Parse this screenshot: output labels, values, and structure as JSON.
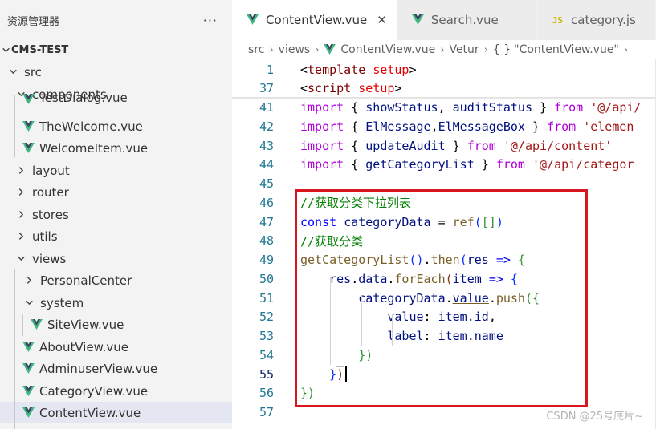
{
  "sidebar": {
    "title": "资源管理器",
    "more": "···",
    "project": "CMS-TEST",
    "items": [
      {
        "label": "src",
        "type": "folder",
        "open": true
      },
      {
        "label": "components",
        "type": "folder",
        "open": true
      },
      {
        "label": "TestDialog.vue",
        "type": "vue"
      },
      {
        "label": "TheWelcome.vue",
        "type": "vue"
      },
      {
        "label": "WelcomeItem.vue",
        "type": "vue"
      },
      {
        "label": "layout",
        "type": "folder",
        "open": false
      },
      {
        "label": "router",
        "type": "folder",
        "open": false
      },
      {
        "label": "stores",
        "type": "folder",
        "open": false
      },
      {
        "label": "utils",
        "type": "folder",
        "open": false
      },
      {
        "label": "views",
        "type": "folder",
        "open": true
      },
      {
        "label": "PersonalCenter",
        "type": "folder",
        "open": false
      },
      {
        "label": "system",
        "type": "folder",
        "open": true
      },
      {
        "label": "SiteView.vue",
        "type": "vue"
      },
      {
        "label": "AboutView.vue",
        "type": "vue"
      },
      {
        "label": "AdminuserView.vue",
        "type": "vue"
      },
      {
        "label": "CategoryView.vue",
        "type": "vue"
      },
      {
        "label": "ContentView.vue",
        "type": "vue",
        "selected": true
      }
    ]
  },
  "tabs": [
    {
      "label": "ContentView.vue",
      "icon": "vue-icon",
      "active": true,
      "close": "✕"
    },
    {
      "label": "Search.vue",
      "icon": "vue-icon",
      "active": false
    },
    {
      "label": "category.js",
      "icon": "js-icon",
      "badge": "JS",
      "active": false
    }
  ],
  "breadcrumb": {
    "parts": [
      "src",
      "views",
      "ContentView.vue",
      "Vetur",
      "\"ContentView.vue\""
    ],
    "curly": "{ }"
  },
  "code": {
    "line_numbers": [
      "1",
      "37",
      "41",
      "42",
      "43",
      "44",
      "45",
      "46",
      "47",
      "48",
      "49",
      "50",
      "51",
      "52",
      "53",
      "54",
      "55",
      "56",
      "57"
    ],
    "lines": [
      [
        [
          "t-pn",
          "<"
        ],
        [
          "t-tag",
          "template"
        ],
        [
          "t-pn",
          " "
        ],
        [
          "t-attr",
          "setup"
        ],
        [
          "t-pn",
          ">"
        ]
      ],
      [
        [
          "t-pn",
          "<"
        ],
        [
          "t-tag",
          "script"
        ],
        [
          "t-pn",
          " "
        ],
        [
          "t-attr",
          "setup"
        ],
        [
          "t-pn",
          ">"
        ]
      ],
      [
        [
          "t-kw2",
          "import"
        ],
        [
          "t-pn",
          " { "
        ],
        [
          "t-var",
          "showStatus"
        ],
        [
          "t-pn",
          ", "
        ],
        [
          "t-var",
          "auditStatus"
        ],
        [
          "t-pn",
          " } "
        ],
        [
          "t-kw2",
          "from"
        ],
        [
          "t-pn",
          " "
        ],
        [
          "t-str",
          "'@/api/"
        ]
      ],
      [
        [
          "t-kw2",
          "import"
        ],
        [
          "t-pn",
          " { "
        ],
        [
          "t-var",
          "ElMessage"
        ],
        [
          "t-pn",
          ","
        ],
        [
          "t-var",
          "ElMessageBox"
        ],
        [
          "t-pn",
          " } "
        ],
        [
          "t-kw2",
          "from"
        ],
        [
          "t-pn",
          " "
        ],
        [
          "t-str",
          "'elemen"
        ]
      ],
      [
        [
          "t-kw2",
          "import"
        ],
        [
          "t-pn",
          " { "
        ],
        [
          "t-var",
          "updateAudit"
        ],
        [
          "t-pn",
          " } "
        ],
        [
          "t-kw2",
          "from"
        ],
        [
          "t-pn",
          " "
        ],
        [
          "t-str",
          "'@/api/content'"
        ]
      ],
      [
        [
          "t-kw2",
          "import"
        ],
        [
          "t-pn",
          " { "
        ],
        [
          "t-var",
          "getCategoryList"
        ],
        [
          "t-pn",
          " } "
        ],
        [
          "t-kw2",
          "from"
        ],
        [
          "t-pn",
          " "
        ],
        [
          "t-str",
          "'@/api/categor"
        ]
      ],
      [],
      [
        [
          "t-cm",
          "//获取分类下拉列表"
        ]
      ],
      [
        [
          "t-kw",
          "const"
        ],
        [
          "t-pn",
          " "
        ],
        [
          "t-var",
          "categoryData"
        ],
        [
          "t-pn",
          " = "
        ],
        [
          "t-fn",
          "ref"
        ],
        [
          "t-br1",
          "("
        ],
        [
          "t-br2",
          "[]"
        ],
        [
          "t-br1",
          ")"
        ]
      ],
      [
        [
          "t-cm",
          "//获取分类"
        ]
      ],
      [
        [
          "t-fn",
          "getCategoryList"
        ],
        [
          "t-br1",
          "()"
        ],
        [
          "t-pn",
          "."
        ],
        [
          "t-fn",
          "then"
        ],
        [
          "t-br1",
          "("
        ],
        [
          "t-var",
          "res"
        ],
        [
          "t-pn",
          " "
        ],
        [
          "t-kw",
          "=>"
        ],
        [
          "t-pn",
          " "
        ],
        [
          "t-br2",
          "{"
        ]
      ],
      [
        [
          "t-pn",
          "    "
        ],
        [
          "t-var",
          "res"
        ],
        [
          "t-pn",
          "."
        ],
        [
          "t-var",
          "data"
        ],
        [
          "t-pn",
          "."
        ],
        [
          "t-fn",
          "forEach"
        ],
        [
          "t-br3",
          "("
        ],
        [
          "t-var",
          "item"
        ],
        [
          "t-pn",
          " "
        ],
        [
          "t-kw",
          "=>"
        ],
        [
          "t-pn",
          " "
        ],
        [
          "t-br1",
          "{"
        ]
      ],
      [
        [
          "t-pn",
          "        "
        ],
        [
          "t-var",
          "categoryData"
        ],
        [
          "t-pn",
          "."
        ],
        [
          "t-var ul",
          "value"
        ],
        [
          "t-pn",
          "."
        ],
        [
          "t-fn",
          "push"
        ],
        [
          "t-br2",
          "({"
        ]
      ],
      [
        [
          "t-pn",
          "            "
        ],
        [
          "t-var",
          "value"
        ],
        [
          "t-pn",
          ": "
        ],
        [
          "t-var",
          "item"
        ],
        [
          "t-pn",
          "."
        ],
        [
          "t-var",
          "id"
        ],
        [
          "t-pn",
          ","
        ]
      ],
      [
        [
          "t-pn",
          "            "
        ],
        [
          "t-var",
          "label"
        ],
        [
          "t-pn",
          ": "
        ],
        [
          "t-var",
          "item"
        ],
        [
          "t-pn",
          "."
        ],
        [
          "t-var",
          "name"
        ]
      ],
      [
        [
          "t-pn",
          "        "
        ],
        [
          "t-br2",
          "})"
        ]
      ],
      [
        [
          "t-pn",
          "    "
        ],
        [
          "t-br1",
          "}"
        ],
        [
          "t-br3 bracket-match",
          ")"
        ]
      ],
      [
        [
          "t-br2",
          "})"
        ]
      ],
      []
    ]
  },
  "watermark": "CSDN @25号底片~",
  "colors": {
    "highlight_box": "#d9161e",
    "sidebar_bg": "#f3f3f3",
    "selected_row": "#e4e6f1",
    "line_number": "#237893"
  }
}
